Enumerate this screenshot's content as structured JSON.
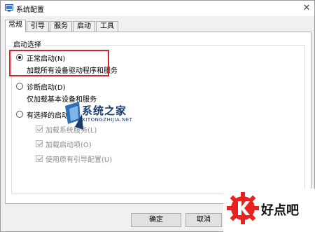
{
  "window": {
    "title": "系统配置"
  },
  "tabs": [
    {
      "label": "常规"
    },
    {
      "label": "引导"
    },
    {
      "label": "服务"
    },
    {
      "label": "启动"
    },
    {
      "label": "工具"
    }
  ],
  "startup_selection": {
    "group_title": "启动选择",
    "normal": {
      "label": "正常启动(N)",
      "description": "加载所有设备驱动程序和服务",
      "selected": true
    },
    "diagnostic": {
      "label": "诊断启动(D)",
      "description": "仅加载基本设备和服务",
      "selected": false
    },
    "selective": {
      "label": "有选择的启动(S)",
      "selected": false,
      "options": [
        {
          "label": "加载系统服务(L)",
          "checked": true
        },
        {
          "label": "加载启动项(O)",
          "checked": true
        },
        {
          "label": "使用原有引导配置(U)",
          "checked": true
        }
      ]
    }
  },
  "buttons": {
    "ok": "确定",
    "cancel": "取消"
  },
  "watermarks": {
    "center_title": "系统之家",
    "center_url": "XITONGZHIJIA.NET",
    "corner_title": "好点吧"
  },
  "colors": {
    "highlight": "#d2232a",
    "corner_logo": "#e8231f",
    "watermark_blue": "#1a3a6a"
  }
}
